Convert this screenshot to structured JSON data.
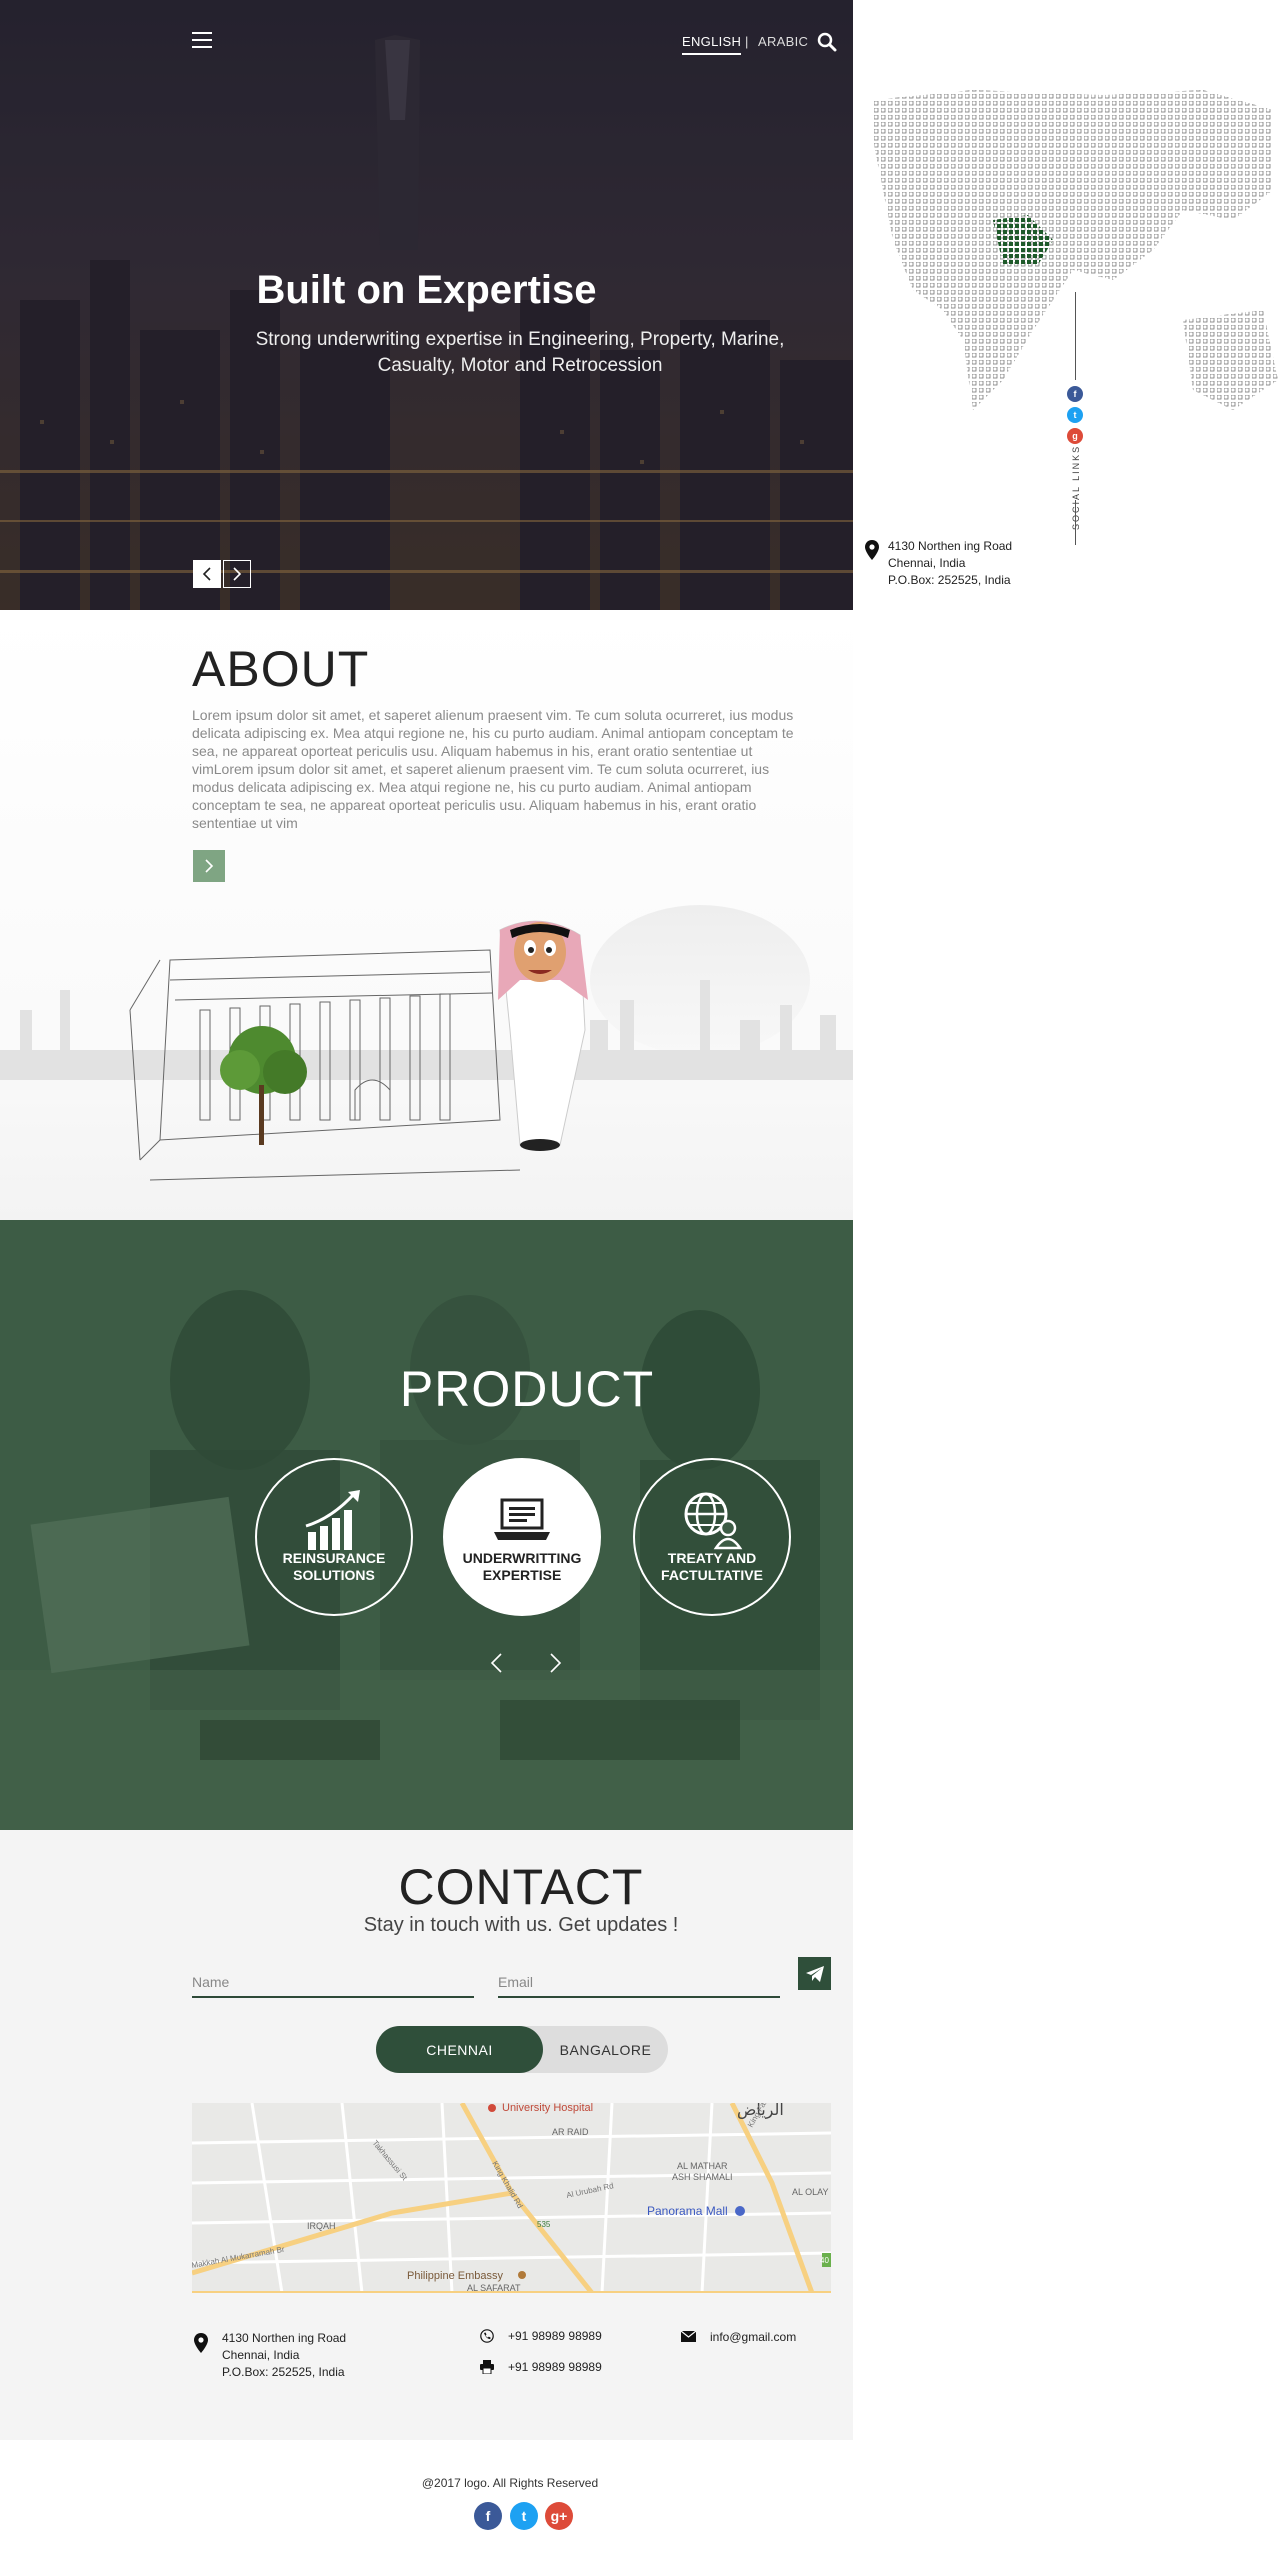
{
  "header": {
    "lang_english": "ENGLISH",
    "lang_separator": "|",
    "lang_arabic": "ARABIC"
  },
  "hero": {
    "title": "Built on Expertise",
    "subtitle": "Strong underwriting expertise in Engineering, Property, Marine, Casualty, Motor and Retrocession"
  },
  "side": {
    "social_label": "SOCIAL LINKS",
    "social_icons": [
      "f",
      "t",
      "g"
    ],
    "address_line1": "4130 Northen ing Road",
    "address_line2": "Chennai, India",
    "address_line3": "P.O.Box: 252525, India"
  },
  "about": {
    "title": "ABOUT",
    "body": "Lorem ipsum dolor sit amet, et saperet alienum praesent vim. Te cum soluta ocurreret, ius modus delicata adipiscing ex. Mea atqui regione ne, his cu purto audiam. Animal antiopam conceptam te sea, ne appareat oporteat periculis usu. Aliquam habemus in his, erant oratio sententiae ut vimLorem ipsum dolor sit amet, et saperet alienum praesent vim. Te cum soluta ocurreret, ius modus delicata adipiscing ex. Mea atqui regione ne, his cu purto audiam. Animal antiopam conceptam te sea, ne appareat oporteat periculis usu. Aliquam habemus in his, erant oratio sententiae ut vim"
  },
  "product": {
    "title": "PRODUCT",
    "items": [
      {
        "label": "REINSURANCE SOLUTIONS",
        "icon": "growth-chart-icon"
      },
      {
        "label": "UNDERWRITTING EXPERTISE",
        "icon": "laptop-icon"
      },
      {
        "label": "TREATY AND FACTULTATIVE",
        "icon": "globe-user-icon"
      }
    ]
  },
  "contact": {
    "title": "CONTACT",
    "subtitle": "Stay in touch with us. Get updates !",
    "name_placeholder": "Name",
    "email_placeholder": "Email",
    "tabs": [
      "CHENNAI",
      "BANGALORE"
    ],
    "map_labels": {
      "hospital": "University Hospital",
      "riyadh_ar": "الرياض",
      "ar_raid": "AR RAID",
      "al_mathar": "AL MATHAR",
      "ash_shamali": "ASH SHAMALI",
      "al_olay": "AL OLAY",
      "panorama": "Panorama Mall",
      "irqah": "IRQAH",
      "philippine": "Philippine Embassy",
      "al_safarat": "AL SAFARAT",
      "king_khalid": "King Khalid Rd",
      "king_fahd": "King Fahd Rd",
      "road_535": "535",
      "mushaf": "Makkah Al Mukarramah Br",
      "urubah": "Al Urubah Rd",
      "takhassusi": "Takhassusi St",
      "road_40": "40"
    },
    "address_line1": "4130 Northen ing Road",
    "address_line2": "Chennai, India",
    "address_line3": "P.O.Box: 252525, India",
    "phone": "+91 98989 98989",
    "fax": "+91 98989 98989",
    "email": "info@gmail.com"
  },
  "footer": {
    "copyright": "@2017 logo. All Rights Reserved",
    "social": [
      "f",
      "t",
      "g+"
    ]
  },
  "colors": {
    "brand_green": "#2f4f3a",
    "accent_green": "#7fa583",
    "facebook": "#3b5998",
    "twitter": "#1da1f2",
    "google": "#dd4b39"
  }
}
